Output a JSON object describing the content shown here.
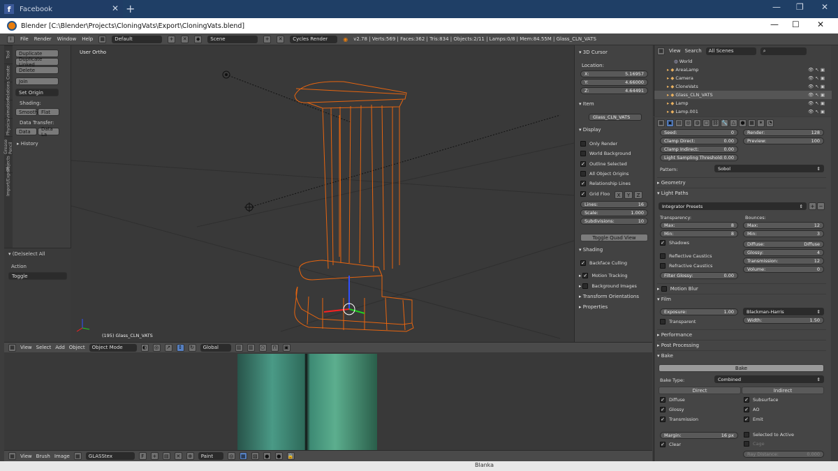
{
  "browser": {
    "tab_title": "Facebook",
    "fb_letter": "f",
    "close_glyph": "✕",
    "new_tab_glyph": "+",
    "win_min": "—",
    "win_max": "❐",
    "win_close": "✕"
  },
  "window": {
    "title": "Blender [C:\\Blender\\Projects\\CloningVats\\Export\\CloningVats.blend]",
    "min": "—",
    "max": "☐",
    "close": "✕"
  },
  "info_header": {
    "menus": [
      "File",
      "Render",
      "Window",
      "Help"
    ],
    "layout": "Default",
    "scene": "Scene",
    "engine": "Cycles Render",
    "stats": "v2.78 | Verts:569 | Faces:362 | Tris:834 | Objects:2/11 | Lamps:0/8 | Mem:84.55M | Glass_CLN_VATS"
  },
  "toolshelf": {
    "tabs": [
      "Tool",
      "Create",
      "Relations",
      "Animation",
      "Physics",
      "Grease Pencil",
      "Objects",
      "Import/Export"
    ],
    "buttons": [
      "Duplicate",
      "Duplicate Linked",
      "Delete",
      "Join"
    ],
    "set_origin": "Set Origin",
    "shading_label": "Shading:",
    "smooth": "Smooth",
    "flat": "Flat",
    "data_transfer_label": "Data Transfer:",
    "data": "Data",
    "data_la": "Data La",
    "history": "History",
    "operator": "(De)select All",
    "action_label": "Action",
    "action_value": "Toggle"
  },
  "viewport": {
    "view_label": "User Ortho",
    "object_label": "(195) Glass_CLN_VATS"
  },
  "npanel": {
    "cursor_title": "3D Cursor",
    "location_label": "Location:",
    "x_label": "X:",
    "x": "5.16957",
    "y_label": "Y:",
    "y": "4.66000",
    "z_label": "Z:",
    "z": "4.64491",
    "item_title": "Item",
    "item_name": "Glass_CLN_VATS",
    "display_title": "Display",
    "only_render": "Only Render",
    "world_background": "World Background",
    "outline_selected": "Outline Selected",
    "all_object_origins": "All Object Origins",
    "relationship_lines": "Relationship Lines",
    "grid_floor": "Grid Floo",
    "axis_x": "X",
    "axis_y": "Y",
    "axis_z": "Z",
    "lines_label": "Lines:",
    "lines": "16",
    "scale_label": "Scale:",
    "scale": "1.000",
    "subdiv_label": "Subdivisions:",
    "subdiv": "10",
    "toggle_quad": "Toggle Quad View",
    "shading_title": "Shading",
    "backface": "Backface Culling",
    "motion_tracking": "Motion Tracking",
    "background_images": "Background Images",
    "transform_orientations": "Transform Orientations",
    "properties": "Properties"
  },
  "viewport_header": {
    "menus": [
      "View",
      "Select",
      "Add",
      "Object"
    ],
    "mode": "Object Mode",
    "orientation": "Global"
  },
  "image_header": {
    "menus": [
      "View",
      "Brush",
      "Image"
    ],
    "image_name": "GLASStex",
    "f_label": "F",
    "paint": "Paint"
  },
  "outliner": {
    "menus": [
      "View",
      "Search"
    ],
    "filter": "All Scenes",
    "items": [
      "World",
      "AreaLamp",
      "Camera",
      "CloneVats",
      "Glass_CLN_VATS",
      "Lamp",
      "Lamp.001"
    ]
  },
  "properties": {
    "seed_label": "Seed:",
    "seed": "0",
    "clamp_direct_label": "Clamp Direct:",
    "clamp_direct": "0.00",
    "clamp_indirect_label": "Clamp Indirect:",
    "clamp_indirect": "0.00",
    "light_threshold_label": "Light Sampling Threshold:",
    "light_threshold": "0.00",
    "render_label": "Render:",
    "render": "128",
    "preview_label": "Preview:",
    "preview": "100",
    "pattern_label": "Pattern:",
    "pattern": "Sobol",
    "geometry": "Geometry",
    "light_paths": "Light Paths",
    "integrator_presets": "Integrator Presets",
    "transparency_label": "Transparency:",
    "t_max_label": "Max:",
    "t_max": "8",
    "t_min_label": "Min:",
    "t_min": "8",
    "shadows": "Shadows",
    "reflective_caustics": "Reflective Caustics",
    "refractive_caustics": "Refractive Caustics",
    "filter_glossy_label": "Filter Glossy:",
    "filter_glossy": "0.00",
    "bounces_label": "Bounces:",
    "b_max_label": "Max:",
    "b_max": "12",
    "b_min_label": "Min:",
    "b_min": "3",
    "diffuse_label": "Diffuse:",
    "diffuse": "Diffuse",
    "glossy_label": "Glossy:",
    "glossy": "4",
    "transmission_label": "Transmission:",
    "transmission": "12",
    "volume_label": "Volume:",
    "volume": "0",
    "motion_blur": "Motion Blur",
    "film": "Film",
    "exposure_label": "Exposure:",
    "exposure": "1.00",
    "transparent": "Transparent",
    "filter_type": "Blackman-Harris",
    "width_label": "Width:",
    "width": "1.50",
    "performance": "Performance",
    "post_processing": "Post Processing",
    "bake": "Bake",
    "bake_button": "Bake",
    "bake_type_label": "Bake Type:",
    "bake_type": "Combined",
    "direct": "Direct",
    "indirect": "Indirect",
    "glossy_cb": "Glossy",
    "transmission_cb": "Transmission",
    "subsurface": "Subsurface",
    "ao": "AO",
    "emit": "Emit",
    "margin_label": "Margin:",
    "margin": "16 px",
    "clear": "Clear",
    "selected_to_active": "Selected to Active",
    "cage": "Cage",
    "ray_distance_label": "Ray Distance:",
    "ray_distance": "0.000"
  },
  "taskbar": {
    "user": "Blanka"
  }
}
